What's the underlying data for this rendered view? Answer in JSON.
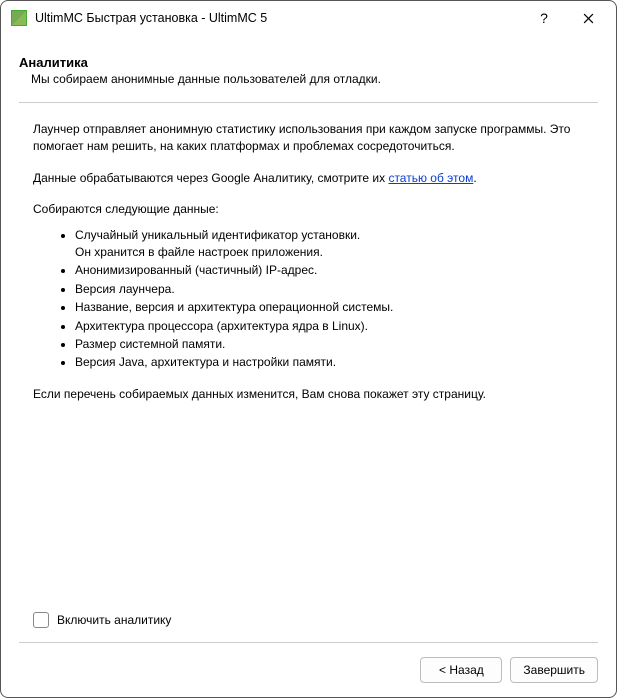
{
  "titlebar": {
    "title": "UltimMC Быстрая установка - UltimMC 5"
  },
  "header": {
    "title": "Аналитика",
    "subtitle": "Мы собираем анонимные данные пользователей для отладки."
  },
  "body": {
    "para1": "Лаунчер отправляет анонимную статистику использования при каждом запуске программы. Это помогает нам решить, на каких платформах и проблемах сосредоточиться.",
    "para2_prefix": "Данные обрабатываются через Google Аналитику, смотрите их ",
    "para2_link": "статью об этом",
    "para2_suffix": ".",
    "para3": "Собираются следующие данные:",
    "items": [
      "Случайный уникальный идентификатор установки.\nОн хранится в файле настроек приложения.",
      "Анонимизированный (частичный) IP-адрес.",
      "Версия лаунчера.",
      "Название, версия и архитектура операционной системы.",
      "Архитектура процессора (архитектура ядра в Linux).",
      "Размер системной памяти.",
      "Версия Java, архитектура и настройки памяти."
    ],
    "para4": "Если перечень собираемых данных изменится, Вам снова покажет эту страницу."
  },
  "checkbox": {
    "label": "Включить аналитику",
    "checked": false
  },
  "footer": {
    "back": "< Назад",
    "finish": "Завершить"
  }
}
